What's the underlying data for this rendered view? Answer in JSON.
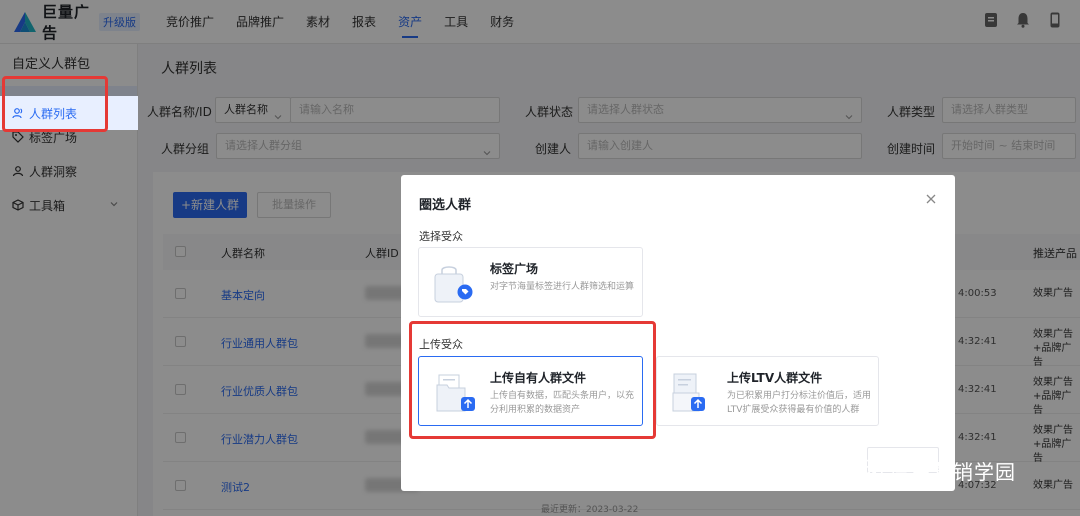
{
  "brand": {
    "name": "巨量广告",
    "badge": "升级版",
    "colors": {
      "primary": "#2a6bf2",
      "logo_teal": "#1fb6c7",
      "logo_blue": "#2a6bf2",
      "highlight_red": "#e53935"
    }
  },
  "nav": {
    "items": [
      "竞价推广",
      "品牌推广",
      "素材",
      "报表",
      "资产",
      "工具",
      "财务"
    ],
    "active_index": 4
  },
  "top_icons": [
    "document-icon",
    "bell-icon",
    "phone-icon"
  ],
  "sidebar": {
    "header": "自定义人群包",
    "items": [
      {
        "label": "人群列表",
        "icon": "users-icon",
        "active": true
      },
      {
        "label": "标签广场",
        "icon": "tag-icon",
        "active": false
      },
      {
        "label": "人群洞察",
        "icon": "user-icon",
        "active": false
      },
      {
        "label": "工具箱",
        "icon": "cube-icon",
        "active": false,
        "expandable": true
      }
    ]
  },
  "page": {
    "title": "人群列表",
    "filters": {
      "name_id_label": "人群名称/ID",
      "name_select": "人群名称",
      "name_placeholder": "请输入名称",
      "status_label": "人群状态",
      "status_placeholder": "请选择人群状态",
      "type_label": "人群类型",
      "type_placeholder": "请选择人群类型",
      "group_label": "人群分组",
      "group_placeholder": "请选择人群分组",
      "creator_label": "创建人",
      "creator_placeholder": "请输入创建人",
      "time_label": "创建时间",
      "time_placeholder": "开始时间 ~ 结束时间"
    },
    "toolbar": {
      "new_label": "+新建人群",
      "batch_label": "批量操作"
    },
    "table": {
      "headers": {
        "name": "人群名称",
        "id": "人群ID",
        "product": "推送产品"
      },
      "rows": [
        {
          "name": "基本定向",
          "time": "4:00:53",
          "product": "效果广告"
        },
        {
          "name": "行业通用人群包",
          "time": "4:32:41",
          "product": "效果广告+品牌广告"
        },
        {
          "name": "行业优质人群包",
          "time": "4:32:41",
          "product": "效果广告+品牌广告"
        },
        {
          "name": "行业潜力人群包",
          "time": "4:32:41",
          "product": "效果广告+品牌广告"
        },
        {
          "name": "测试2",
          "time": "4:07:32",
          "product": "效果广告",
          "updated": "最近更新：2023-03-22"
        }
      ]
    }
  },
  "modal": {
    "title": "圈选人群",
    "section_select": "选择受众",
    "section_upload": "上传受众",
    "cards": {
      "tag_square": {
        "title": "标签广场",
        "desc": "对字节海量标签进行人群筛选和运算"
      },
      "upload_own": {
        "title": "上传自有人群文件",
        "desc": "上传自有数据，匹配头条用户，以充分利用积累的数据资产"
      },
      "upload_ltv": {
        "title": "上传LTV人群文件",
        "desc": "为已积累用户打分标注价值后，适用LTV扩展受众获得最有价值的人群"
      }
    }
  },
  "watermark": {
    "text": "厚昌营销学园"
  }
}
